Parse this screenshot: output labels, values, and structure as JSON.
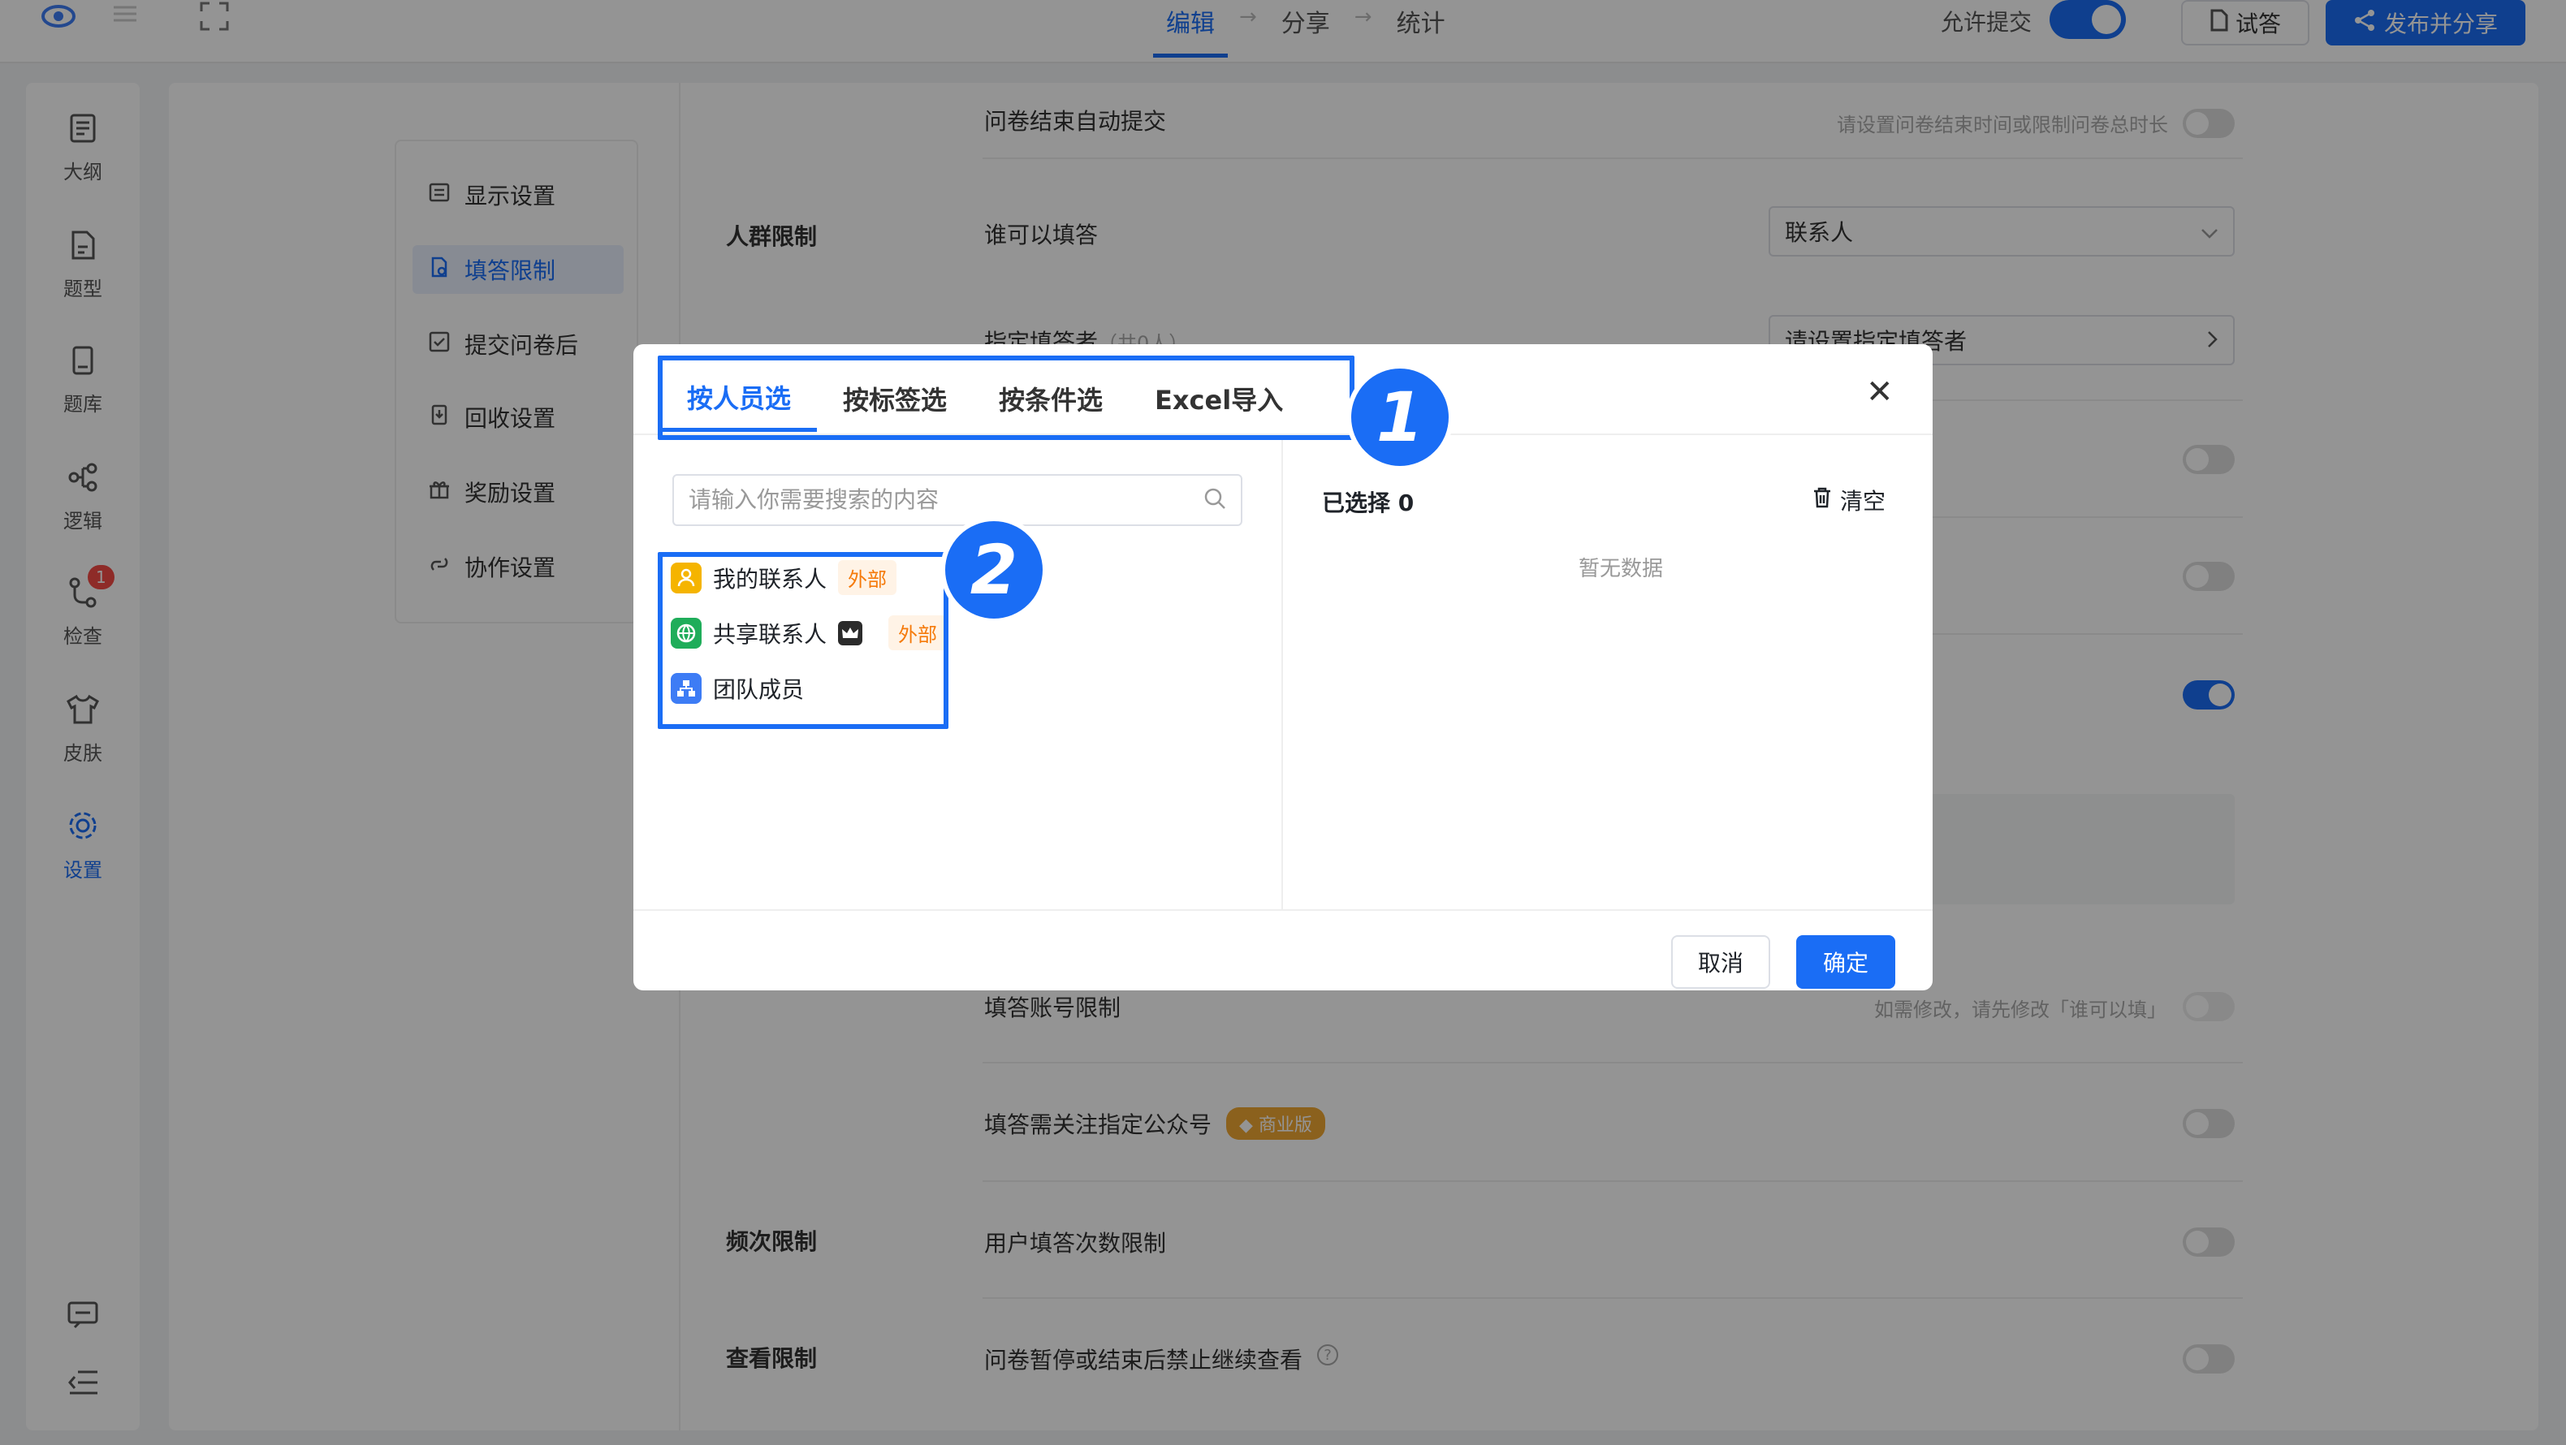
{
  "topbar": {
    "steps": [
      "编辑",
      "分享",
      "统计"
    ],
    "allow_submit": "允许提交",
    "try_label": "试答",
    "publish_label": "发布并分享"
  },
  "leftnav": {
    "items": [
      {
        "label": "大纲",
        "icon": "outline-icon"
      },
      {
        "label": "题型",
        "icon": "question-type-icon"
      },
      {
        "label": "题库",
        "icon": "question-bank-icon"
      },
      {
        "label": "逻辑",
        "icon": "logic-icon"
      },
      {
        "label": "检查",
        "icon": "check-icon",
        "badge": "1"
      },
      {
        "label": "皮肤",
        "icon": "skin-icon"
      },
      {
        "label": "设置",
        "icon": "settings-icon",
        "active": true
      }
    ]
  },
  "submenu": {
    "items": [
      {
        "label": "显示设置"
      },
      {
        "label": "填答限制",
        "active": true
      },
      {
        "label": "提交问卷后"
      },
      {
        "label": "回收设置"
      },
      {
        "label": "奖励设置"
      },
      {
        "label": "协作设置"
      }
    ]
  },
  "settings": {
    "auto_submit": "问卷结束自动提交",
    "auto_submit_hint": "请设置问卷结束时间或限制问卷总时长",
    "crowd_group": "人群限制",
    "who_can_answer": "谁可以填答",
    "who_can_answer_value": "联系人",
    "designated": "指定填答者",
    "designated_count": "（共0人）",
    "designated_placeholder": "请设置指定填答者",
    "account_limit": "填答账号限制",
    "account_limit_hint": "如需修改，请先修改「谁可以填」",
    "follow_account": "填答需关注指定公众号",
    "commercial_badge": "商业版",
    "frequency_group": "频次限制",
    "frequency_item": "用户填答次数限制",
    "view_group": "查看限制",
    "view_item": "问卷暂停或结束后禁止继续查看"
  },
  "modal": {
    "tabs": [
      "按人员选",
      "按标签选",
      "按条件选",
      "Excel导入"
    ],
    "search_placeholder": "请输入你需要搜索的内容",
    "list": [
      {
        "label": "我的联系人",
        "tag": "外部",
        "icon": "contact-icon",
        "color": "#f5b400"
      },
      {
        "label": "共享联系人",
        "tag": "外部",
        "icon": "globe-icon",
        "color": "#1fad5a"
      },
      {
        "label": "团队成员",
        "icon": "team-icon",
        "color": "#3d7cf5"
      }
    ],
    "selected_label": "已选择 0",
    "clear_label": "清空",
    "empty_text": "暂无数据",
    "cancel_label": "取消",
    "ok_label": "确定"
  },
  "markers": [
    "1",
    "2"
  ]
}
